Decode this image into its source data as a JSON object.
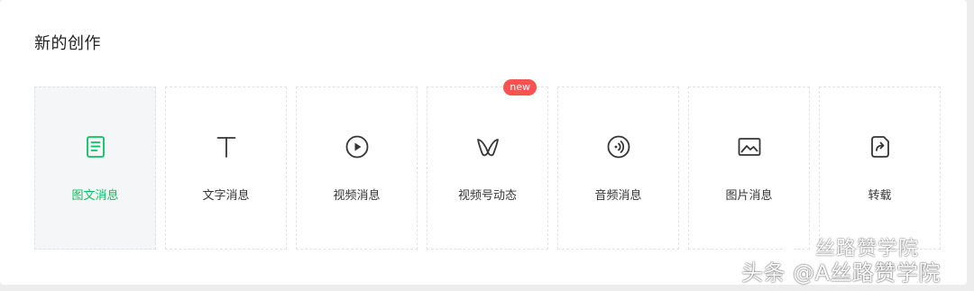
{
  "section": {
    "title": "新的创作"
  },
  "cards": [
    {
      "label": "图文消息",
      "icon": "article-icon",
      "active": true
    },
    {
      "label": "文字消息",
      "icon": "text-icon"
    },
    {
      "label": "视频消息",
      "icon": "video-play-icon"
    },
    {
      "label": "视频号动态",
      "icon": "channels-icon",
      "badge": "new"
    },
    {
      "label": "音频消息",
      "icon": "audio-icon"
    },
    {
      "label": "图片消息",
      "icon": "image-icon"
    },
    {
      "label": "转载",
      "icon": "repost-icon"
    }
  ],
  "watermark": {
    "line1": "丝路赞学院",
    "line2": "头条 @A丝路赞学院",
    "icon": "wechat-icon"
  },
  "colors": {
    "accent": "#07c160",
    "badge": "#fa5151",
    "icon_default": "#353535"
  }
}
